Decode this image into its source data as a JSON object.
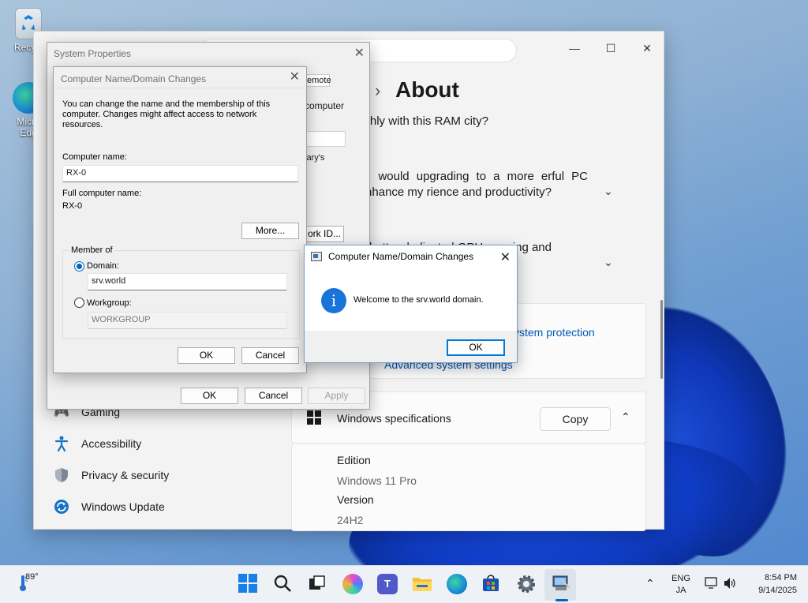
{
  "desktop": {
    "icons": [
      {
        "label": "Recycl"
      },
      {
        "label": "Micro Edg"
      }
    ]
  },
  "settings": {
    "page_title": "About",
    "faq": [
      {
        "text": "ications smoothly with this RAM city?"
      },
      {
        "text": "e an old PC, would upgrading to a more erful PC significantly enhance my rience and productivity?"
      },
      {
        "text": "ics GPU? Is it better dedicated GPU, gaming and"
      }
    ],
    "links": {
      "system_protection": "ystem protection",
      "advanced_system_settings": "Advanced system settings"
    },
    "nav": [
      {
        "label": "Gaming"
      },
      {
        "label": "Accessibility"
      },
      {
        "label": "Privacy & security"
      },
      {
        "label": "Windows Update"
      }
    ],
    "specs": {
      "header": "Windows specifications",
      "copy_label": "Copy",
      "edition_label": "Edition",
      "edition_value": "Windows 11 Pro",
      "version_label": "Version",
      "version_value": "24H2"
    }
  },
  "system_properties": {
    "title": "System Properties",
    "tab_remote": "emote",
    "behind_text_1": "computer",
    "behind_text_2": "lary's",
    "network_id_label": "ork ID...",
    "ok": "OK",
    "cancel": "Cancel",
    "apply": "Apply"
  },
  "name_changes": {
    "title": "Computer Name/Domain Changes",
    "intro": "You can change the name and the membership of this computer. Changes might affect access to network resources.",
    "computer_name_label": "Computer name:",
    "computer_name_value": "RX-0",
    "full_name_label": "Full computer name:",
    "full_name_value": "RX-0",
    "more_label": "More...",
    "member_of_label": "Member of",
    "domain_label": "Domain:",
    "domain_value": "srv.world",
    "workgroup_label": "Workgroup:",
    "workgroup_value": "WORKGROUP",
    "ok": "OK",
    "cancel": "Cancel"
  },
  "welcome_dialog": {
    "title": "Computer Name/Domain Changes",
    "message": "Welcome to the srv.world domain.",
    "ok": "OK"
  },
  "taskbar": {
    "weather": "89°",
    "lang_top": "ENG",
    "lang_bottom": "JA",
    "time": "8:54 PM",
    "date": "9/14/2025"
  },
  "colors": {
    "accent": "#0067c0",
    "link": "#0058b8",
    "info_icon": "#1a73d9"
  }
}
